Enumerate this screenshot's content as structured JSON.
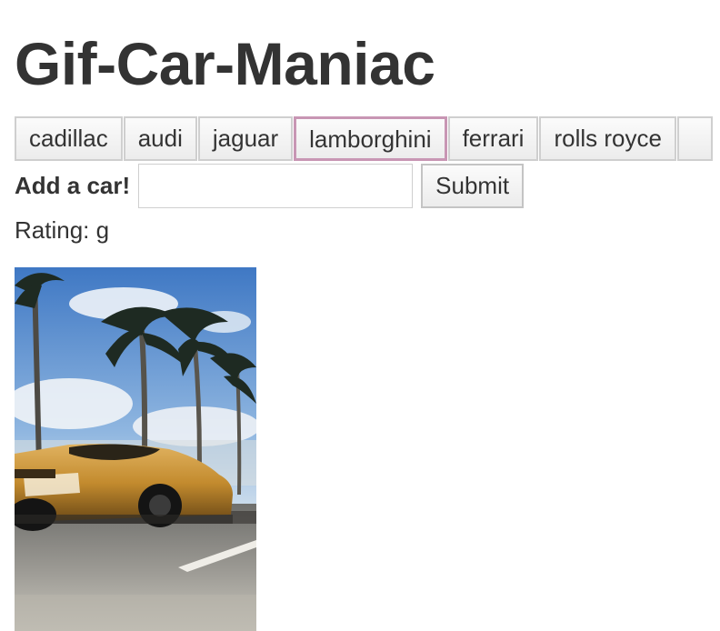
{
  "page": {
    "title": "Gif-Car-Maniac"
  },
  "car_buttons": [
    {
      "label": "cadillac"
    },
    {
      "label": "audi"
    },
    {
      "label": "jaguar"
    },
    {
      "label": "lamborghini"
    },
    {
      "label": "ferrari"
    },
    {
      "label": "rolls royce"
    }
  ],
  "add_form": {
    "label": "Add a car!",
    "input_value": "",
    "submit_label": "Submit"
  },
  "gifs": [
    {
      "rating_text": "Rating: g",
      "alt": "lamborghini gif"
    }
  ],
  "colors": {
    "focus_border": "#c896b4",
    "text": "#333333",
    "button_border": "#cfcfcf"
  }
}
